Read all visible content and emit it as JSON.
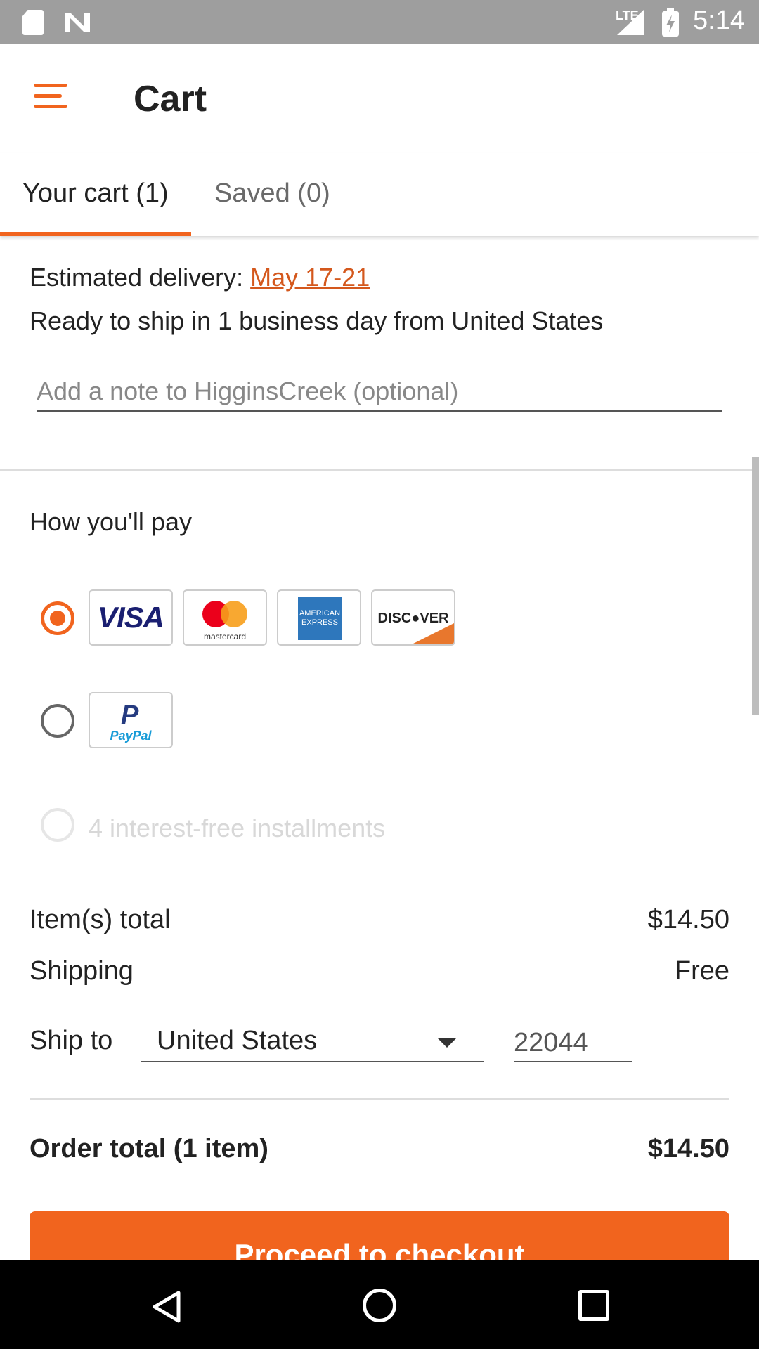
{
  "status_bar": {
    "time": "5:14",
    "network": "LTE",
    "icons": [
      "sd-card-icon",
      "n-notification-icon",
      "signal-icon",
      "battery-charging-icon"
    ]
  },
  "header": {
    "title": "Cart",
    "menu_icon": "hamburger-menu-icon",
    "accent_color": "#f1641e"
  },
  "tabs": [
    {
      "label": "Your cart (1)",
      "active": true
    },
    {
      "label": "Saved (0)",
      "active": false
    }
  ],
  "delivery": {
    "estimated_label": "Estimated delivery:",
    "estimated_dates": "May 17-21",
    "ship_info": "Ready to ship in 1 business day from United States",
    "note_placeholder": "Add a note to HigginsCreek (optional)"
  },
  "payment": {
    "heading": "How you'll pay",
    "options": [
      {
        "type": "card",
        "selected": true,
        "cards": [
          "VISA",
          "mastercard",
          "AMERICAN EXPRESS",
          "DISCOVER"
        ]
      },
      {
        "type": "paypal",
        "selected": false,
        "label": "PayPal"
      },
      {
        "type": "installments",
        "selected": false,
        "disabled": true,
        "label": "4 interest-free installments"
      }
    ],
    "amex_line1": "AMERICAN",
    "amex_line2": "EXPRESS",
    "discover_text": "DISC●VER",
    "paypal_mark": "P"
  },
  "summary": {
    "items_total_label": "Item(s) total",
    "items_total_value": "$14.50",
    "shipping_label": "Shipping",
    "shipping_value": "Free",
    "ship_to_label": "Ship to",
    "country": "United States",
    "zip": "22044",
    "order_total_label": "Order total (1 item)",
    "order_total_value": "$14.50"
  },
  "checkout_button": "Proceed to checkout"
}
